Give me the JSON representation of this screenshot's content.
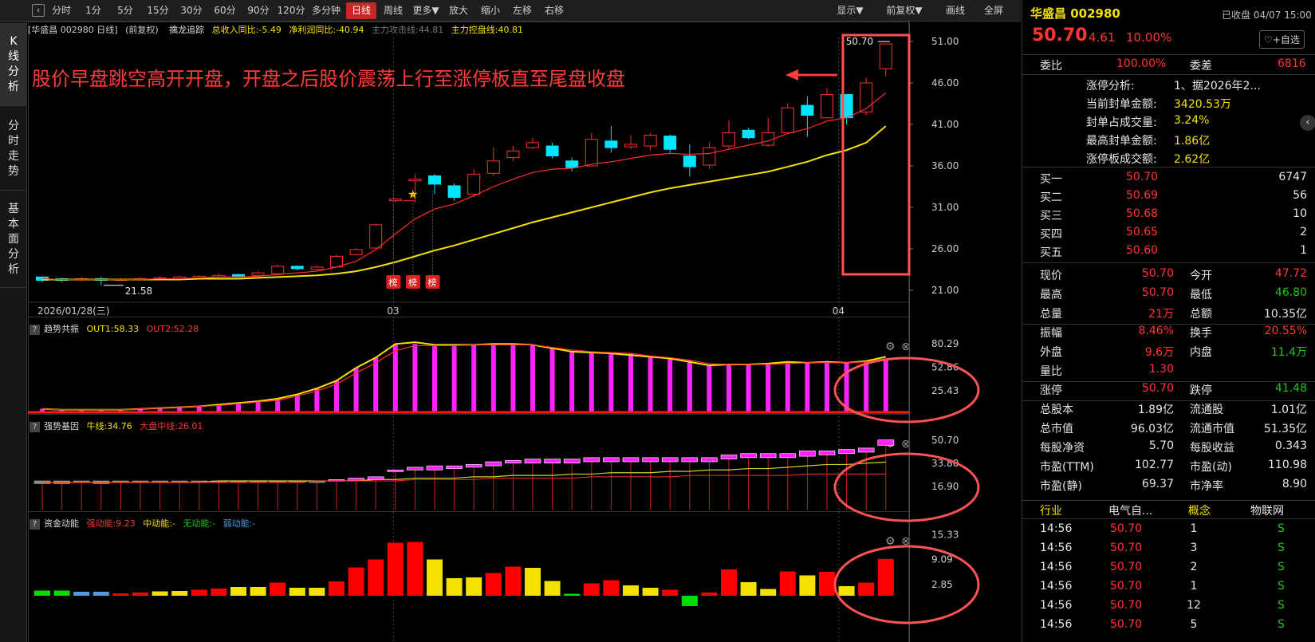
{
  "toolbar": {
    "items": [
      "分时",
      "1分",
      "5分",
      "15分",
      "30分",
      "60分",
      "90分",
      "120分",
      "多分钟",
      "日线",
      "周线",
      "更多▼",
      "放大",
      "缩小",
      "左移",
      "右移"
    ],
    "active": "日线",
    "right": [
      "显示▼",
      "前复权▼",
      "画线",
      "全屏"
    ]
  },
  "left_tabs": [
    [
      "K",
      "线",
      "分",
      "析"
    ],
    [
      "分",
      "时",
      "走",
      "势"
    ],
    [
      "基",
      "本",
      "面",
      "分",
      "析"
    ]
  ],
  "main_info": {
    "stock": "[华盛昌 002980 日线]",
    "adj": "(前复权)",
    "indicator": "擒龙追踪",
    "rev_label": "总收入同比:",
    "rev_val": "-5.49",
    "np_label": "净利润同比:",
    "np_val": "-40.94",
    "atk_label": "主力攻击线:",
    "atk_val": "44.81",
    "ctrl_label": "主力控盘线:",
    "ctrl_val": "40.81"
  },
  "annotation": "股价早盘跳空高开开盘，开盘之后股价震荡上行至涨停板直至尾盘收盘",
  "price_high_label": "50.70",
  "price_low_label": "21.58",
  "date_labels": {
    "start": "2026/01/28(三)",
    "mar": "03",
    "apr": "04"
  },
  "bang_label": "榜",
  "sub1": {
    "name": "趋势共振",
    "l1": "OUT1:",
    "v1": "58.33",
    "l2": "OUT2:",
    "v2": "52.28",
    "ticks": [
      "80.29",
      "52.86",
      "25.43"
    ]
  },
  "sub2": {
    "name": "强势基因",
    "l1": "牛线:",
    "v1": "34.76",
    "l2": "大盘中线:",
    "v2": "26.01",
    "ticks": [
      "50.70",
      "33.80",
      "16.90"
    ]
  },
  "sub3": {
    "name": "资金动能",
    "l1": "强动能:",
    "v1": "9.23",
    "l2": "中动能:",
    "v2": "-",
    "l3": "无动能:",
    "v3": "-",
    "l4": "弱动能:",
    "v4": "-",
    "ticks": [
      "15.33",
      "9.09",
      "2.85"
    ]
  },
  "chart_data": {
    "type": "candlestick",
    "price_axis": {
      "ylim": [
        21,
        51
      ],
      "ticks": [
        "51.00",
        "46.00",
        "41.00",
        "36.00",
        "31.00",
        "26.00",
        "21.00"
      ]
    },
    "candles": [
      [
        22.6,
        22.2,
        22.7,
        22.0
      ],
      [
        22.4,
        22.2,
        22.5,
        22.0
      ],
      [
        22.3,
        22.4,
        22.6,
        22.1
      ],
      [
        22.4,
        22.2,
        22.6,
        21.6
      ],
      [
        22.2,
        22.3,
        22.5,
        22.1
      ],
      [
        22.3,
        22.4,
        22.6,
        22.2
      ],
      [
        22.4,
        22.5,
        22.7,
        22.3
      ],
      [
        22.4,
        22.6,
        22.8,
        22.3
      ],
      [
        22.4,
        22.7,
        22.8,
        22.3
      ],
      [
        22.6,
        22.8,
        23.0,
        22.5
      ],
      [
        22.9,
        22.7,
        23.0,
        22.6
      ],
      [
        22.8,
        23.1,
        23.3,
        22.7
      ],
      [
        23.0,
        23.9,
        24.1,
        22.9
      ],
      [
        23.9,
        23.6,
        24.0,
        23.4
      ],
      [
        23.5,
        23.8,
        24.0,
        23.4
      ],
      [
        23.8,
        25.1,
        25.3,
        23.8
      ],
      [
        25.3,
        25.9,
        26.1,
        25.2
      ],
      [
        26.1,
        28.9,
        29.0,
        26.0
      ],
      [
        31.8,
        32.0,
        32.1,
        31.6
      ],
      [
        34.2,
        34.4,
        35.0,
        31.6
      ],
      [
        34.8,
        33.8,
        35.0,
        32.6
      ],
      [
        33.6,
        32.2,
        33.9,
        31.8
      ],
      [
        32.6,
        35.0,
        35.6,
        32.2
      ],
      [
        35.1,
        36.6,
        38.2,
        34.8
      ],
      [
        37.0,
        37.8,
        38.4,
        36.6
      ],
      [
        38.2,
        38.8,
        39.4,
        38.0
      ],
      [
        38.4,
        37.2,
        38.8,
        36.9
      ],
      [
        36.6,
        35.8,
        37.0,
        35.3
      ],
      [
        36.0,
        39.2,
        40.0,
        35.9
      ],
      [
        39.0,
        38.2,
        40.8,
        37.6
      ],
      [
        38.3,
        38.6,
        39.7,
        38.0
      ],
      [
        38.4,
        39.7,
        40.0,
        37.8
      ],
      [
        39.6,
        38.0,
        39.8,
        37.6
      ],
      [
        37.2,
        35.9,
        38.6,
        34.7
      ],
      [
        36.1,
        38.2,
        38.8,
        35.6
      ],
      [
        38.4,
        40.0,
        41.5,
        38.0
      ],
      [
        40.3,
        39.4,
        40.6,
        39.2
      ],
      [
        38.5,
        40.0,
        41.8,
        38.3
      ],
      [
        40.0,
        43.0,
        43.5,
        39.9
      ],
      [
        43.3,
        42.1,
        44.4,
        39.5
      ],
      [
        41.8,
        44.6,
        45.4,
        41.7
      ],
      [
        44.6,
        41.8,
        44.7,
        41.0
      ],
      [
        42.5,
        46.0,
        46.6,
        42.1
      ],
      [
        47.72,
        50.7,
        50.7,
        46.8
      ]
    ],
    "ma_fast": [
      22.4,
      22.3,
      22.3,
      22.3,
      22.3,
      22.3,
      22.4,
      22.4,
      22.5,
      22.6,
      22.6,
      22.7,
      22.9,
      23.1,
      23.3,
      23.8,
      24.5,
      25.9,
      27.8,
      29.6,
      30.8,
      31.4,
      32.4,
      33.5,
      34.4,
      35.2,
      35.6,
      35.7,
      36.2,
      36.5,
      36.9,
      37.3,
      37.5,
      37.4,
      37.5,
      38.0,
      38.5,
      39.0,
      39.9,
      40.5,
      41.4,
      41.8,
      42.9,
      44.8
    ],
    "ma_slow": [
      22.3,
      22.3,
      22.3,
      22.3,
      22.3,
      22.3,
      22.3,
      22.3,
      22.4,
      22.4,
      22.4,
      22.5,
      22.6,
      22.7,
      22.8,
      23.0,
      23.3,
      23.8,
      24.4,
      25.1,
      25.8,
      26.4,
      27.1,
      27.8,
      28.5,
      29.2,
      29.8,
      30.4,
      31.0,
      31.6,
      32.2,
      32.8,
      33.3,
      33.7,
      34.1,
      34.5,
      34.9,
      35.3,
      35.9,
      36.5,
      37.3,
      37.9,
      38.8,
      40.8
    ],
    "trend": {
      "ylim": [
        0,
        84
      ],
      "bars": [
        4,
        3,
        3,
        3,
        3,
        4,
        5,
        6,
        7,
        9,
        11,
        13,
        16,
        21,
        28,
        37,
        52,
        64,
        80,
        80,
        79,
        79,
        79,
        79,
        80,
        79,
        76,
        72,
        70,
        70,
        69,
        66,
        64,
        61,
        56,
        56,
        56,
        56,
        58,
        58,
        58,
        58,
        60,
        63
      ],
      "out1": [
        4,
        3,
        3,
        3,
        3,
        4,
        5,
        6,
        7,
        9,
        11,
        13,
        16,
        21,
        28,
        37,
        52,
        64,
        80,
        82,
        79,
        79,
        79,
        80,
        80,
        79,
        75,
        71,
        70,
        69,
        67,
        65,
        63,
        59,
        55,
        56,
        56,
        57,
        59,
        58,
        59,
        58,
        60,
        65
      ],
      "out2": [
        4,
        3,
        3,
        3,
        3,
        4,
        5,
        6,
        7,
        8,
        10,
        12,
        14,
        19,
        25,
        33,
        46,
        58,
        72,
        78,
        78,
        78,
        79,
        79,
        79,
        79,
        76,
        73,
        71,
        70,
        69,
        66,
        64,
        61,
        57,
        56,
        56,
        56,
        57,
        58,
        58,
        58,
        59,
        62
      ]
    },
    "gene": {
      "ylim": [
        0,
        56
      ],
      "boxes": [
        [
          19,
          21
        ],
        [
          19,
          21
        ],
        [
          20,
          21
        ],
        [
          19,
          21
        ],
        [
          20,
          21
        ],
        [
          20,
          21
        ],
        [
          20,
          21
        ],
        [
          20,
          21
        ],
        [
          20,
          21
        ],
        [
          20,
          21
        ],
        [
          20,
          21
        ],
        [
          20,
          21
        ],
        [
          20,
          21
        ],
        [
          20,
          21
        ],
        [
          20,
          21
        ],
        [
          21,
          22
        ],
        [
          21,
          23
        ],
        [
          22,
          24
        ],
        [
          28,
          29
        ],
        [
          29,
          31
        ],
        [
          29,
          32
        ],
        [
          30,
          32
        ],
        [
          31,
          33
        ],
        [
          32,
          35
        ],
        [
          34,
          36
        ],
        [
          34,
          37
        ],
        [
          34,
          37
        ],
        [
          34,
          37
        ],
        [
          35,
          38
        ],
        [
          35,
          38
        ],
        [
          35,
          38
        ],
        [
          35,
          38
        ],
        [
          35,
          38
        ],
        [
          35,
          38
        ],
        [
          35,
          38
        ],
        [
          37,
          40
        ],
        [
          38,
          41
        ],
        [
          38,
          41
        ],
        [
          38,
          41
        ],
        [
          39,
          43
        ],
        [
          40,
          43
        ],
        [
          41,
          44
        ],
        [
          42,
          45
        ],
        [
          47,
          51
        ]
      ],
      "bull": [
        20,
        20,
        20,
        20,
        20,
        20,
        20,
        20,
        20,
        21,
        21,
        21,
        21,
        21,
        21,
        21,
        21,
        22,
        22,
        23,
        23,
        23,
        24,
        24,
        25,
        25,
        25,
        26,
        26,
        27,
        27,
        27,
        28,
        28,
        29,
        29,
        30,
        30,
        31,
        32,
        33,
        33,
        34,
        34.76
      ],
      "market": [
        20,
        20,
        20,
        20,
        20,
        20,
        20,
        20,
        20,
        20,
        20,
        20,
        20,
        20,
        21,
        21,
        21,
        21,
        21,
        22,
        22,
        22,
        22,
        23,
        23,
        23,
        23,
        23,
        24,
        24,
        24,
        24,
        24,
        25,
        25,
        25,
        25,
        25,
        25,
        26,
        26,
        26,
        26,
        26.01
      ]
    },
    "fund": {
      "ylim": [
        0,
        16
      ],
      "values": [
        1.3,
        1.3,
        1.0,
        1.0,
        0.6,
        0.8,
        1.1,
        1.2,
        1.5,
        1.8,
        2.2,
        2.2,
        3.3,
        2.0,
        2.0,
        3.6,
        7.1,
        9.1,
        13.3,
        13.5,
        9.1,
        4.4,
        4.6,
        5.7,
        7.3,
        7.0,
        3.7,
        0.5,
        3.1,
        3.9,
        2.6,
        2.0,
        1.5,
        2.6,
        0.8,
        6.6,
        3.4,
        1.7,
        6.1,
        5.1,
        6.0,
        2.4,
        3.3,
        9.23
      ],
      "colors": [
        "#00dd00",
        "#00dd00",
        "#4d9de0",
        "#4d9de0",
        "#ff0000",
        "#ff0000",
        "#f5e100",
        "#f5e100",
        "#ff0000",
        "#ff0000",
        "#f5e100",
        "#f5e100",
        "#ff0000",
        "#f5e100",
        "#f5e100",
        "#ff0000",
        "#ff0000",
        "#ff0000",
        "#ff0000",
        "#ff0000",
        "#f5e100",
        "#f5e100",
        "#f5e100",
        "#ff0000",
        "#ff0000",
        "#f5e100",
        "#f5e100",
        "#00dd00",
        "#ff0000",
        "#ff0000",
        "#f5e100",
        "#f5e100",
        "#ff0000",
        "#00dd00",
        "#ff0000",
        "#ff0000",
        "#f5e100",
        "#f5e100",
        "#ff0000",
        "#f5e100",
        "#ff0000",
        "#f5e100",
        "#ff0000",
        "#ff0000"
      ],
      "below": [
        0,
        0,
        0,
        0,
        0,
        0,
        0,
        0,
        0,
        0,
        0,
        0,
        0,
        0,
        0,
        0,
        0,
        0,
        0,
        0,
        0,
        0,
        0,
        0,
        0,
        0,
        0,
        0,
        0,
        0,
        0,
        0,
        0,
        1,
        0,
        0,
        0,
        0,
        0,
        0,
        0,
        0,
        0,
        0
      ]
    }
  },
  "quote": {
    "name": "华盛昌 002980",
    "status": "已收盘 04/07 15:00",
    "price": "50.70",
    "change": "4.61",
    "pct": "10.00%",
    "fav": "♡+自选",
    "wb_label": "委比",
    "wb_val": "100.00%",
    "wc_label": "委差",
    "wc_val": "6816",
    "limit_info": [
      [
        "涨停分析:",
        "1、据2026年2..."
      ],
      [
        "当前封单金额:",
        "3420.53万"
      ],
      [
        "封单占成交量:",
        "3.24%"
      ],
      [
        "最高封单金额:",
        "1.86亿"
      ],
      [
        "涨停板成交额:",
        "2.62亿"
      ]
    ],
    "bids": [
      [
        "买一",
        "50.70",
        "6747"
      ],
      [
        "买二",
        "50.69",
        "56"
      ],
      [
        "买三",
        "50.68",
        "10"
      ],
      [
        "买四",
        "50.65",
        "2"
      ],
      [
        "买五",
        "50.60",
        "1"
      ]
    ],
    "stats": [
      [
        "现价",
        "50.70",
        "今开",
        "47.72"
      ],
      [
        "最高",
        "50.70",
        "最低",
        "46.80"
      ],
      [
        "总量",
        "21万",
        "总额",
        "10.35亿"
      ],
      [
        "振幅",
        "8.46%",
        "换手",
        "20.55%"
      ],
      [
        "外盘",
        "9.6万",
        "内盘",
        "11.4万"
      ],
      [
        "量比",
        "1.30",
        "",
        ""
      ],
      [
        "涨停",
        "50.70",
        "跌停",
        "41.48"
      ],
      [
        "总股本",
        "1.89亿",
        "流通股",
        "1.01亿"
      ],
      [
        "总市值",
        "96.03亿",
        "流通市值",
        "51.35亿"
      ],
      [
        "每股净资",
        "5.70",
        "每股收益",
        "0.343"
      ],
      [
        "市盈(TTM)",
        "102.77",
        "市盈(动)",
        "110.98"
      ],
      [
        "市盈(静)",
        "69.37",
        "市净率",
        "8.90"
      ]
    ],
    "industry": [
      "行业",
      "电气自...",
      "概念",
      "物联网"
    ],
    "ticks": [
      [
        "14:56",
        "50.70",
        "1",
        "S"
      ],
      [
        "14:56",
        "50.70",
        "3",
        "S"
      ],
      [
        "14:56",
        "50.70",
        "2",
        "S"
      ],
      [
        "14:56",
        "50.70",
        "1",
        "S"
      ],
      [
        "14:56",
        "50.70",
        "12",
        "S"
      ],
      [
        "14:56",
        "50.70",
        "5",
        "S"
      ]
    ]
  }
}
